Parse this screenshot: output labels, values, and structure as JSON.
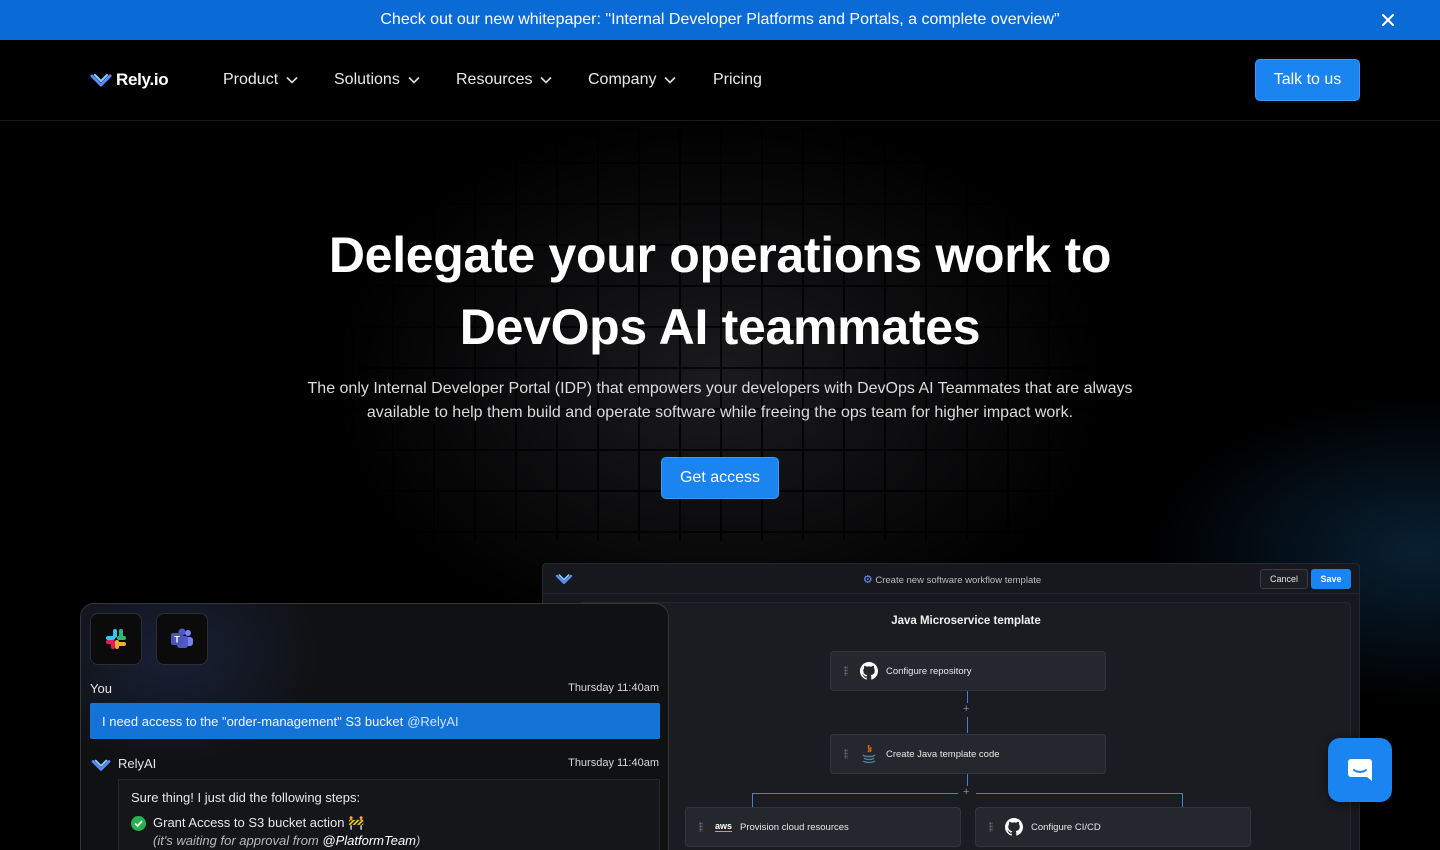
{
  "banner": {
    "text": "Check out our new whitepaper: \"Internal Developer Platforms and Portals, a complete overview\"",
    "close_icon": "close-icon"
  },
  "nav": {
    "logo_text": "Rely.io",
    "items": [
      {
        "label": "Product",
        "dropdown": true
      },
      {
        "label": "Solutions",
        "dropdown": true
      },
      {
        "label": "Resources",
        "dropdown": true
      },
      {
        "label": "Company",
        "dropdown": true
      },
      {
        "label": "Pricing",
        "dropdown": false
      }
    ],
    "cta": "Talk to us"
  },
  "hero": {
    "headline_line1": "Delegate your operations work to",
    "headline_line2": "DevOps AI teammates",
    "subtext": "The only Internal Developer Portal (IDP) that empowers your developers with DevOps AI Teammates that are always available to help them build and operate software while freeing the ops team for higher impact work.",
    "cta": "Get access"
  },
  "workflow": {
    "title": "Create new software workflow template",
    "cancel": "Cancel",
    "save": "Save",
    "template_name": "Java Microservice template",
    "nodes": [
      {
        "label": "Configure repository",
        "icon": "github-icon"
      },
      {
        "label": "Create Java template code",
        "icon": "java-icon"
      },
      {
        "label": "Provision cloud resources",
        "icon": "aws-icon"
      },
      {
        "label": "Configure CI/CD",
        "icon": "github-icon"
      }
    ],
    "aws_text": "aws",
    "plus": "+"
  },
  "chat": {
    "apps": [
      "slack-icon",
      "teams-icon"
    ],
    "user_name": "You",
    "user_time": "Thursday 11:40am",
    "user_message": "I need access to the \"order-management\" S3 bucket",
    "user_mention": "@RelyAI",
    "bot_name": "RelyAI",
    "bot_time": "Thursday 11:40am",
    "bot_intro": "Sure thing! I just did the following steps:",
    "bot_step": "Grant Access to S3 bucket action",
    "bot_step_note_prefix": "(it's waiting for approval from ",
    "bot_step_note_mention": "@PlatformTeam",
    "bot_step_note_suffix": ")"
  },
  "colors": {
    "accent": "#1a84f0",
    "banner": "#0a6ad6",
    "success": "#27b14e"
  }
}
